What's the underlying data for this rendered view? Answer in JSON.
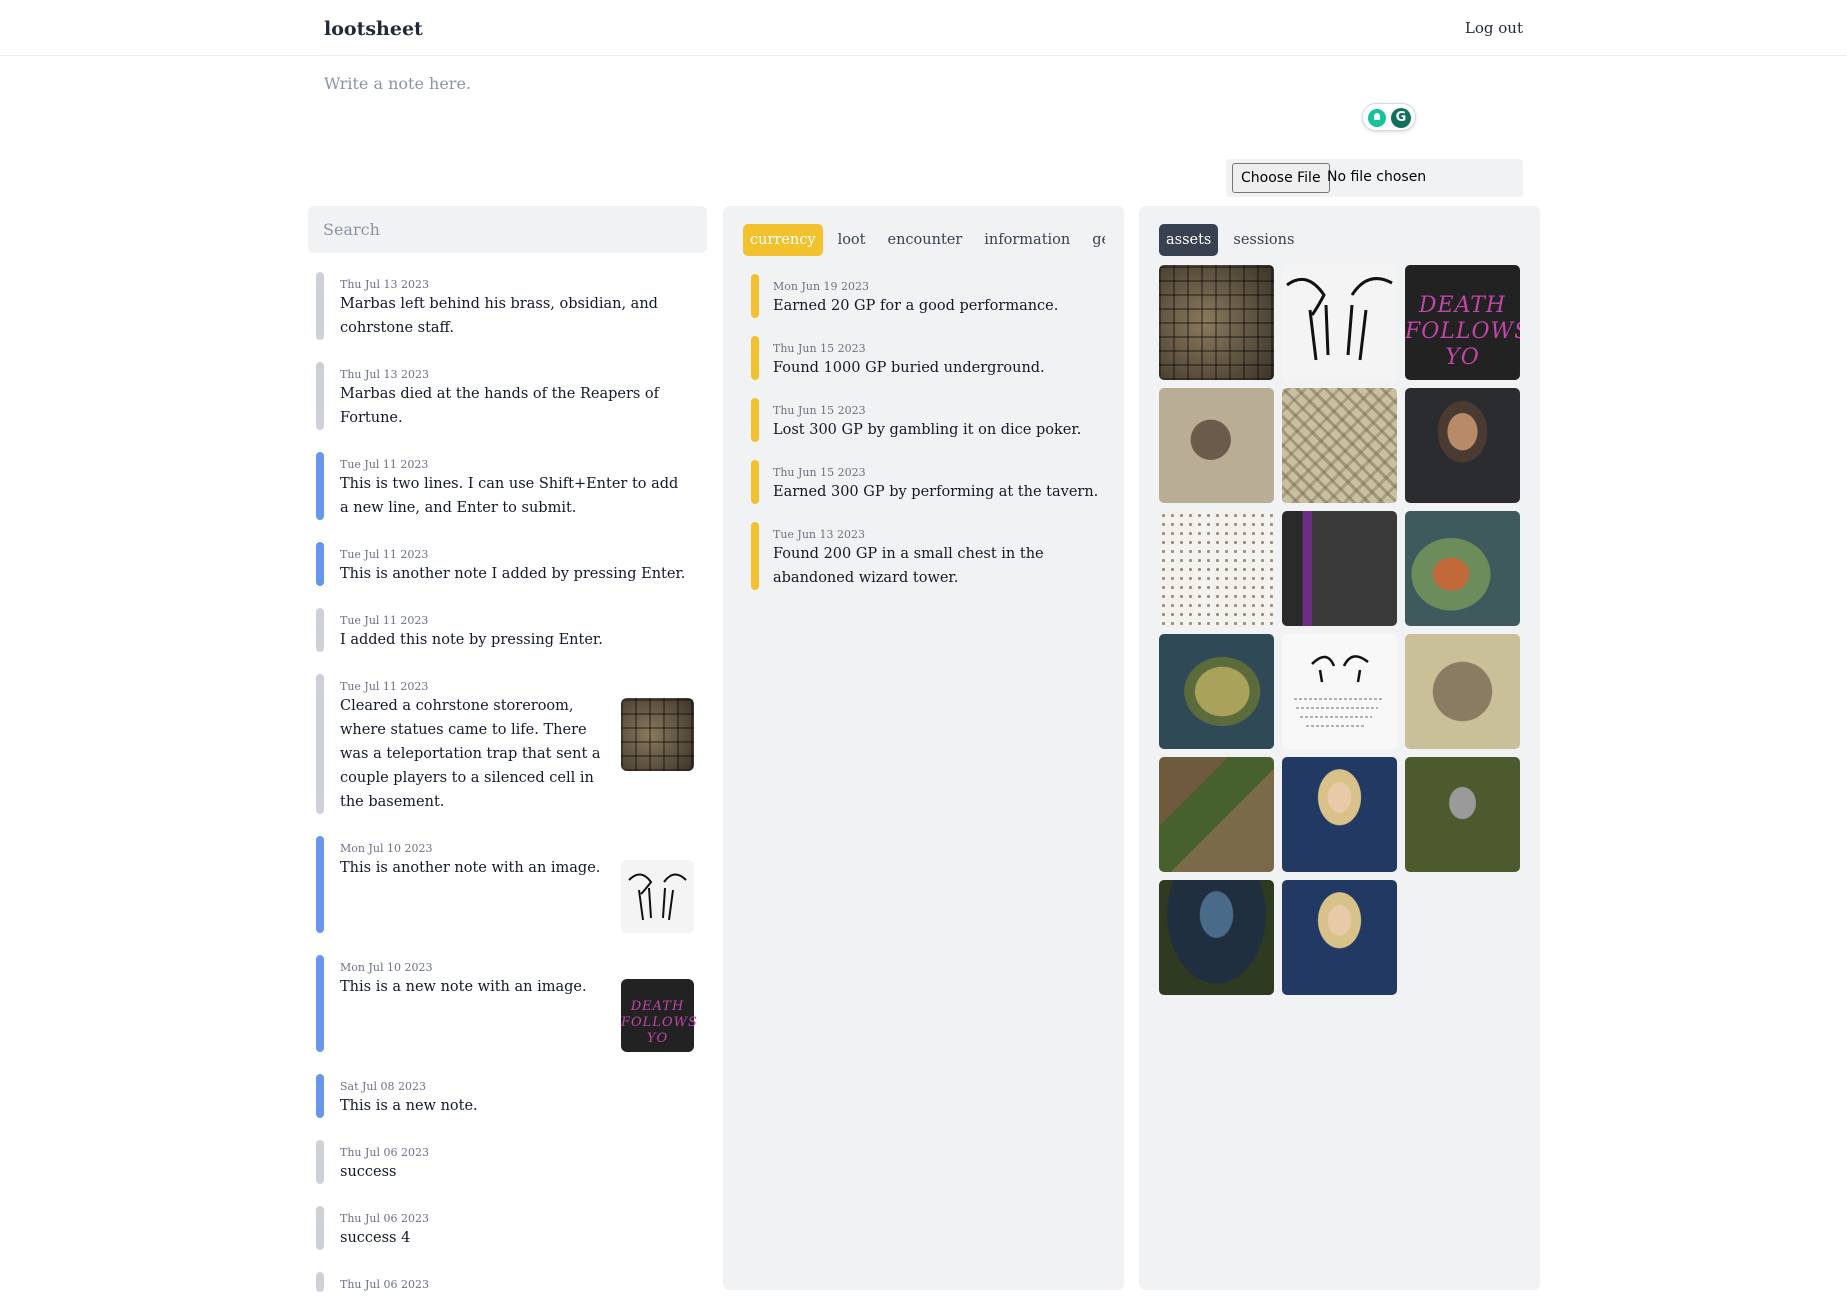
{
  "header": {
    "brand": "lootsheet",
    "logout_label": "Log out"
  },
  "composer": {
    "placeholder": "Write a note here."
  },
  "file_input": {
    "button_label": "Choose File",
    "status": "No file chosen"
  },
  "search": {
    "placeholder": "Search"
  },
  "notes": [
    {
      "date": "Thu Jul 13 2023",
      "text": "Marbas left behind his brass, obsidian, and cohrstone staff.",
      "color": "gray"
    },
    {
      "date": "Thu Jul 13 2023",
      "text": "Marbas died at the hands of the Reapers of Fortune.",
      "color": "gray"
    },
    {
      "date": "Tue Jul 11 2023",
      "text": "This is two lines. I can use Shift+Enter to add a new line, and Enter to submit.",
      "color": "blue"
    },
    {
      "date": "Tue Jul 11 2023",
      "text": "This is another note I added by pressing Enter.",
      "color": "blue"
    },
    {
      "date": "Tue Jul 11 2023",
      "text": "I added this note by pressing Enter.",
      "color": "gray"
    },
    {
      "date": "Tue Jul 11 2023",
      "text": "Cleared a cohrstone storeroom, where statues came to life. There was a teleportation trap that sent a couple players to a silenced cell in the basement.",
      "color": "gray",
      "thumb": "dungeon-map"
    },
    {
      "date": "Mon Jul 10 2023",
      "text": "This is another note with an image.",
      "color": "blue",
      "thumb": "sketch"
    },
    {
      "date": "Mon Jul 10 2023",
      "text": "This is a new note with an image.",
      "color": "blue",
      "thumb": "death-follows"
    },
    {
      "date": "Sat Jul 08 2023",
      "text": "This is a new note.",
      "color": "blue"
    },
    {
      "date": "Thu Jul 06 2023",
      "text": "success",
      "color": "gray"
    },
    {
      "date": "Thu Jul 06 2023",
      "text": "success 4",
      "color": "gray"
    },
    {
      "date": "Thu Jul 06 2023",
      "text": "",
      "color": "gray"
    }
  ],
  "middle": {
    "tabs": [
      "currency",
      "loot",
      "encounter",
      "information",
      "gene"
    ],
    "active_tab": "currency",
    "entries": [
      {
        "date": "Mon Jun 19 2023",
        "text": "Earned 20 GP for a good performance."
      },
      {
        "date": "Thu Jun 15 2023",
        "text": "Found 1000 GP buried underground."
      },
      {
        "date": "Thu Jun 15 2023",
        "text": "Lost 300 GP by gambling it on dice poker."
      },
      {
        "date": "Thu Jun 15 2023",
        "text": "Earned 300 GP by performing at the tavern."
      },
      {
        "date": "Tue Jun 13 2023",
        "text": "Found 200 GP in a small chest in the abandoned wizard tower."
      }
    ]
  },
  "right": {
    "tabs": [
      "assets",
      "sessions"
    ],
    "active_tab": "assets",
    "death_text": "DEATH FOLLOWS YO",
    "thumb_death_text": "DEATH FOLLOWS YO"
  },
  "colors": {
    "accent_yellow": "#f2c12e",
    "note_blue": "#6697ec",
    "note_gray": "#cdd0d8",
    "panel_bg": "#f1f2f4",
    "tab_dark": "#374151"
  }
}
